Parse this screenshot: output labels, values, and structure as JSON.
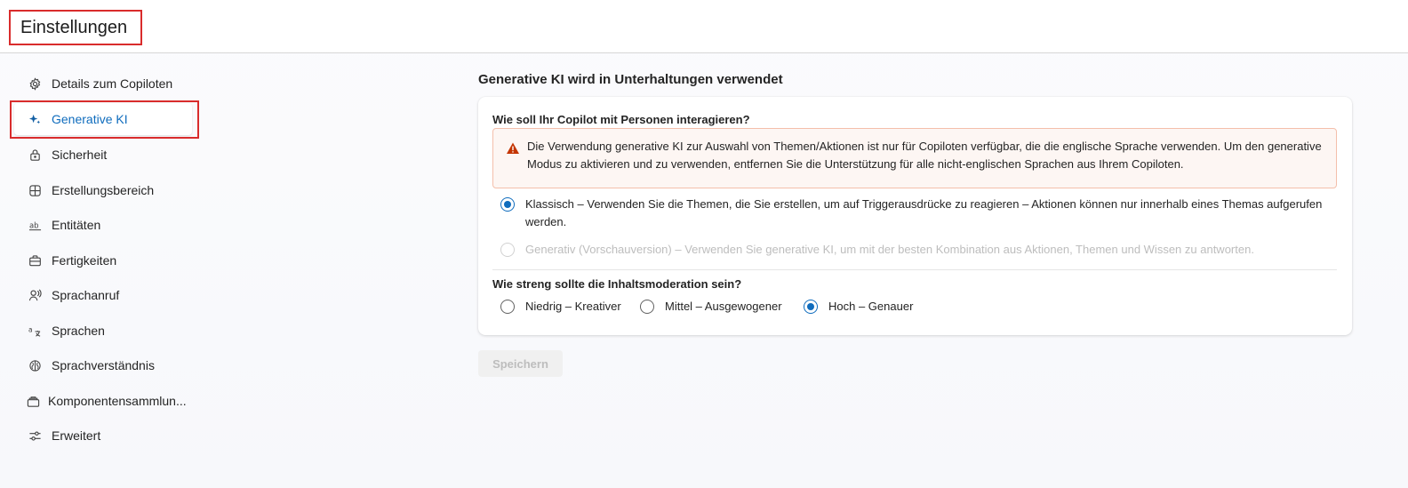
{
  "header": {
    "title": "Einstellungen"
  },
  "sidebar": {
    "items": [
      {
        "label": "Details zum Copiloten",
        "icon": "gear-icon"
      },
      {
        "label": "Generative KI",
        "icon": "sparkle-icon",
        "selected": true
      },
      {
        "label": "Sicherheit",
        "icon": "lock-icon"
      },
      {
        "label": "Erstellungsbereich",
        "icon": "grid-icon"
      },
      {
        "label": "Entitäten",
        "icon": "ab-entity-icon"
      },
      {
        "label": "Fertigkeiten",
        "icon": "briefcase-icon"
      },
      {
        "label": "Sprachanruf",
        "icon": "voice-person-icon"
      },
      {
        "label": "Sprachen",
        "icon": "translate-icon"
      },
      {
        "label": "Sprachverständnis",
        "icon": "brain-icon"
      },
      {
        "label": "Komponentensammlun...",
        "icon": "library-icon"
      },
      {
        "label": "Erweitert",
        "icon": "sliders-icon"
      }
    ]
  },
  "main": {
    "heading": "Generative KI wird in Unterhaltungen verwendet",
    "interaction": {
      "question": "Wie soll Ihr Copilot mit Personen interagieren?",
      "warning": "Die Verwendung generative KI zur Auswahl von Themen/Aktionen ist nur für Copiloten verfügbar, die die englische Sprache verwenden. Um den generative Modus zu aktivieren und zu verwenden, entfernen Sie die Unterstützung für alle nicht-englischen Sprachen aus Ihrem Copiloten.",
      "options": [
        {
          "label": "Klassisch – Verwenden Sie die Themen, die Sie erstellen, um auf Triggerausdrücke zu reagieren – Aktionen können nur innerhalb eines Themas aufgerufen werden.",
          "checked": true,
          "disabled": false
        },
        {
          "label": "Generativ (Vorschauversion) – Verwenden Sie generative KI, um mit der besten Kombination aus Aktionen, Themen und Wissen zu antworten.",
          "checked": false,
          "disabled": true
        }
      ]
    },
    "moderation": {
      "question": "Wie streng sollte die Inhaltsmoderation sein?",
      "options": [
        {
          "label": "Niedrig – Kreativer",
          "checked": false
        },
        {
          "label": "Mittel – Ausgewogener",
          "checked": false
        },
        {
          "label": "Hoch – Genauer",
          "checked": true
        }
      ]
    },
    "save_label": "Speichern"
  },
  "colors": {
    "accent": "#0f6cbd",
    "highlight": "#d92c2c",
    "warning": "#c43501"
  }
}
